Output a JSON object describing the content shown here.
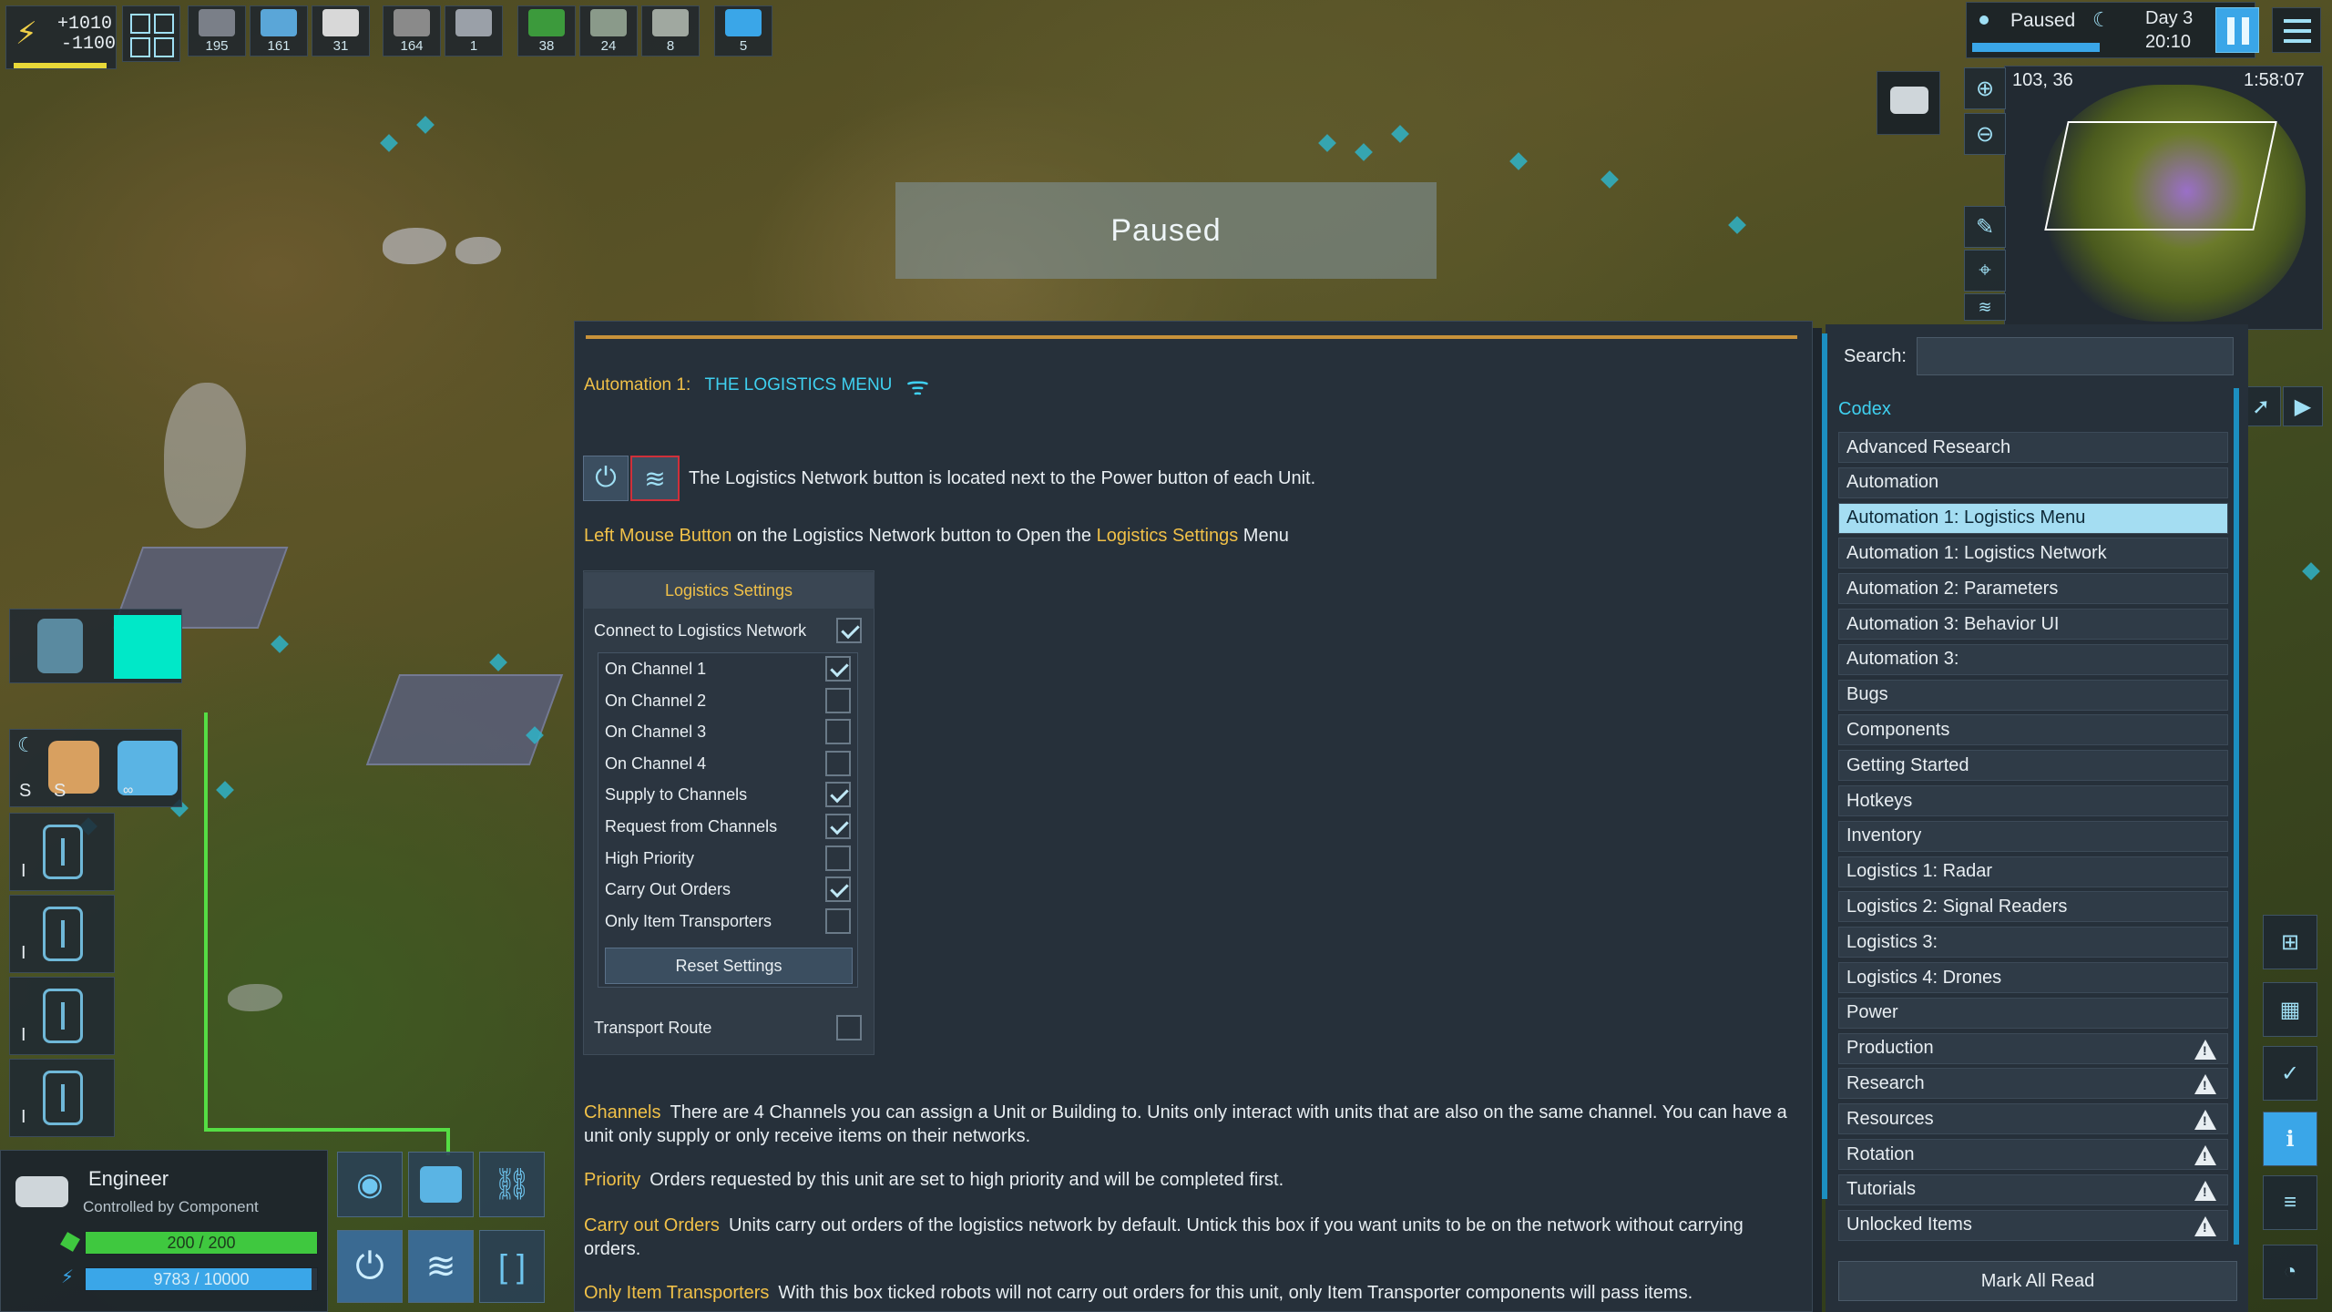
{
  "resources": {
    "power_plus": "+1010",
    "power_minus": "-1100",
    "slots": [
      {
        "icon": "metal-ore-icon",
        "count": "195"
      },
      {
        "icon": "crystal-icon",
        "count": "161"
      },
      {
        "icon": "silica-icon",
        "count": "31"
      },
      {
        "icon": "metal-bar-icon",
        "count": "164"
      },
      {
        "icon": "plate-icon",
        "count": "1"
      },
      {
        "icon": "circuit-icon",
        "count": "38"
      },
      {
        "icon": "foundation-icon",
        "count": "24"
      },
      {
        "icon": "building-icon",
        "count": "8"
      },
      {
        "icon": "blue-crystal-icon",
        "count": "5"
      }
    ]
  },
  "status": {
    "state": "Paused",
    "day": "Day 3",
    "time": "20:10",
    "coords": "103, 36",
    "clock": "1:58:07"
  },
  "banner": {
    "text": "Paused"
  },
  "article": {
    "breadcrumb_prefix": "Automation 1:",
    "title": "THE LOGISTICS MENU",
    "intro": "The Logistics Network button is located next to the Power button of each Unit.",
    "instr_lmb": "Left Mouse Button",
    "instr_mid": "on the Logistics Network button to Open the",
    "instr_menu": "Logistics Settings",
    "instr_end": "Menu",
    "settings": {
      "header": "Logistics Settings",
      "connect_label": "Connect to Logistics Network",
      "connect_checked": true,
      "options": [
        {
          "label": "On Channel 1",
          "checked": true
        },
        {
          "label": "On Channel 2",
          "checked": false
        },
        {
          "label": "On Channel 3",
          "checked": false
        },
        {
          "label": "On Channel 4",
          "checked": false
        },
        {
          "label": "Supply to Channels",
          "checked": true
        },
        {
          "label": "Request from Channels",
          "checked": true
        },
        {
          "label": "High Priority",
          "checked": false
        },
        {
          "label": "Carry Out Orders",
          "checked": true
        },
        {
          "label": "Only Item Transporters",
          "checked": false
        }
      ],
      "reset_label": "Reset Settings",
      "transport_label": "Transport Route",
      "transport_checked": false
    },
    "paragraphs": [
      {
        "term": "Channels",
        "text": "There are 4 Channels you can assign a Unit or Building to. Units only interact with units that are also on the same channel. You can have a unit only supply or only receive items on their networks."
      },
      {
        "term": "Priority",
        "text": "Orders requested by this unit are set to high priority and will be completed first."
      },
      {
        "term": "Carry out Orders",
        "text": "Units carry out orders of the logistics network by default. Untick this box if you want units to be on the network without carrying orders."
      },
      {
        "term": "Only Item Transporters",
        "text": "With this box ticked robots will not carry out orders for this unit, only Item Transporter components will pass items."
      }
    ]
  },
  "codex": {
    "search_label": "Search:",
    "search_value": "",
    "label": "Codex",
    "items": [
      {
        "label": "Advanced Research",
        "warn": false,
        "active": false
      },
      {
        "label": "Automation",
        "warn": false,
        "active": false
      },
      {
        "label": "Automation 1:  Logistics Menu",
        "warn": false,
        "active": true
      },
      {
        "label": "Automation 1:  Logistics Network",
        "warn": false,
        "active": false
      },
      {
        "label": "Automation 2:  Parameters",
        "warn": false,
        "active": false
      },
      {
        "label": "Automation 3:  Behavior UI",
        "warn": false,
        "active": false
      },
      {
        "label": "Automation 3:",
        "warn": false,
        "active": false
      },
      {
        "label": "Bugs",
        "warn": false,
        "active": false
      },
      {
        "label": "Components",
        "warn": false,
        "active": false
      },
      {
        "label": "Getting Started",
        "warn": false,
        "active": false
      },
      {
        "label": "Hotkeys",
        "warn": false,
        "active": false
      },
      {
        "label": "Inventory",
        "warn": false,
        "active": false
      },
      {
        "label": "Logistics 1:  Radar",
        "warn": false,
        "active": false
      },
      {
        "label": "Logistics 2:  Signal Readers",
        "warn": false,
        "active": false
      },
      {
        "label": "Logistics 3:",
        "warn": false,
        "active": false
      },
      {
        "label": "Logistics 4:  Drones",
        "warn": false,
        "active": false
      },
      {
        "label": "Power",
        "warn": false,
        "active": false
      },
      {
        "label": "Production",
        "warn": true,
        "active": false
      },
      {
        "label": "Research",
        "warn": true,
        "active": false
      },
      {
        "label": "Resources",
        "warn": true,
        "active": false
      },
      {
        "label": "Rotation",
        "warn": true,
        "active": false
      },
      {
        "label": "Tutorials",
        "warn": true,
        "active": false
      },
      {
        "label": "Unlocked Items",
        "warn": true,
        "active": false
      }
    ],
    "mark_all_label": "Mark All Read"
  },
  "unit": {
    "name": "Engineer",
    "controller": "Controlled by Component",
    "health": "200 / 200",
    "health_fraction": 1.0,
    "power": "9783 / 10000",
    "power_fraction": 0.9783,
    "slot_labels": [
      "S",
      "S"
    ],
    "inf_label": "∞"
  },
  "colors": {
    "accent_gold": "#f0c048",
    "accent_cyan": "#3fd0f0",
    "health_green": "#3fc83f",
    "power_blue": "#3aa6e8",
    "active_item": "#a4ddf2"
  }
}
